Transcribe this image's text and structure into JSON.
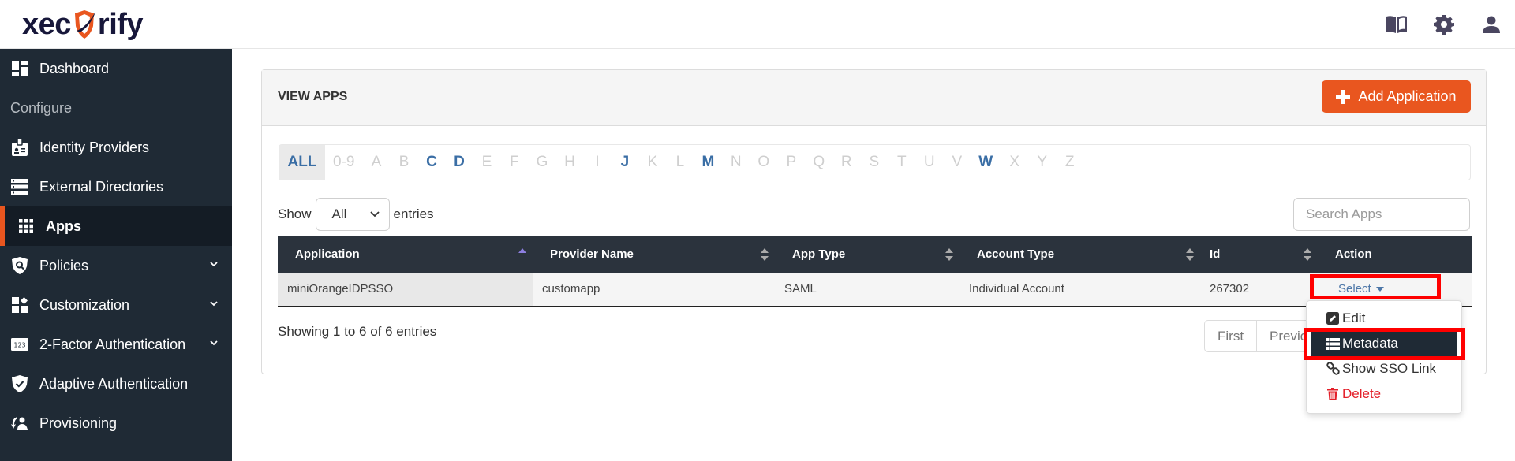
{
  "header": {
    "logo_text_left": "xec",
    "logo_text_right": "rify",
    "icons": [
      "book-icon",
      "gear-icon",
      "user-icon"
    ]
  },
  "sidebar": {
    "items": [
      {
        "label": "Dashboard",
        "icon": "dashboard-icon"
      },
      {
        "section": "Configure"
      },
      {
        "label": "Identity Providers",
        "icon": "id-badge-icon"
      },
      {
        "label": "External Directories",
        "icon": "server-icon"
      },
      {
        "label": "Apps",
        "icon": "apps-grid-icon",
        "active": true
      },
      {
        "label": "Policies",
        "icon": "shield-search-icon",
        "expandable": true
      },
      {
        "label": "Customization",
        "icon": "customize-icon",
        "expandable": true
      },
      {
        "label": "2-Factor Authentication",
        "icon": "numbers-123-icon",
        "expandable": true
      },
      {
        "label": "Adaptive Authentication",
        "icon": "shield-check-icon"
      },
      {
        "label": "Provisioning",
        "icon": "provisioning-icon"
      }
    ]
  },
  "panel": {
    "title": "VIEW APPS",
    "add_button": "Add Application"
  },
  "alpha_filter": {
    "letters": [
      {
        "label": "ALL",
        "state": "selected"
      },
      {
        "label": "0-9",
        "state": "disabled"
      },
      {
        "label": "A",
        "state": "disabled"
      },
      {
        "label": "B",
        "state": "disabled"
      },
      {
        "label": "C",
        "state": "enabled"
      },
      {
        "label": "D",
        "state": "enabled"
      },
      {
        "label": "E",
        "state": "disabled"
      },
      {
        "label": "F",
        "state": "disabled"
      },
      {
        "label": "G",
        "state": "disabled"
      },
      {
        "label": "H",
        "state": "disabled"
      },
      {
        "label": "I",
        "state": "disabled"
      },
      {
        "label": "J",
        "state": "enabled"
      },
      {
        "label": "K",
        "state": "disabled"
      },
      {
        "label": "L",
        "state": "disabled"
      },
      {
        "label": "M",
        "state": "enabled"
      },
      {
        "label": "N",
        "state": "disabled"
      },
      {
        "label": "O",
        "state": "disabled"
      },
      {
        "label": "P",
        "state": "disabled"
      },
      {
        "label": "Q",
        "state": "disabled"
      },
      {
        "label": "R",
        "state": "disabled"
      },
      {
        "label": "S",
        "state": "disabled"
      },
      {
        "label": "T",
        "state": "disabled"
      },
      {
        "label": "U",
        "state": "disabled"
      },
      {
        "label": "V",
        "state": "disabled"
      },
      {
        "label": "W",
        "state": "enabled"
      },
      {
        "label": "X",
        "state": "disabled"
      },
      {
        "label": "Y",
        "state": "disabled"
      },
      {
        "label": "Z",
        "state": "disabled"
      }
    ]
  },
  "length_menu": {
    "prefix": "Show",
    "value": "All",
    "suffix": "entries"
  },
  "search": {
    "placeholder": "Search Apps",
    "value": ""
  },
  "table": {
    "columns": [
      "Application",
      "Provider Name",
      "App Type",
      "Account Type",
      "Id",
      "Action"
    ],
    "rows": [
      {
        "application": "miniOrangeIDPSSO",
        "provider": "customapp",
        "app_type": "SAML",
        "account_type": "Individual Account",
        "id": "267302",
        "action": "Select"
      }
    ]
  },
  "info": "Showing 1 to 6 of 6 entries",
  "pagination": {
    "first": "First",
    "previous": "Previous"
  },
  "action_menu": {
    "items": [
      {
        "label": "Edit",
        "icon": "edit-icon"
      },
      {
        "label": "Metadata",
        "icon": "list-icon",
        "highlighted": true
      },
      {
        "label": "Show SSO Link",
        "icon": "link-icon"
      },
      {
        "label": "Delete",
        "icon": "trash-icon",
        "danger": true
      }
    ]
  },
  "colors": {
    "brand_orange": "#e9561f",
    "sidebar_bg": "#1f2a35",
    "table_header_bg": "#2b333d",
    "link_blue": "#3a6ea5",
    "highlight_red": "#ff0000",
    "danger_red": "#e3202a"
  }
}
